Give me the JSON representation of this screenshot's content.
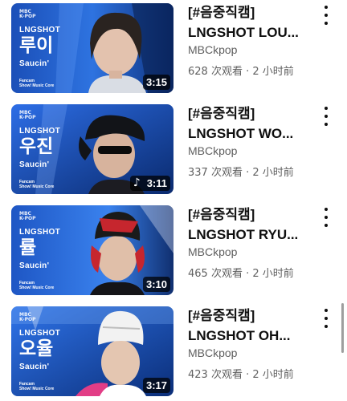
{
  "videos": [
    {
      "thumb_logo": "MBC\nK-POP",
      "thumb_artist": "LNGSHOT",
      "thumb_member": "루이",
      "thumb_song": "Saucin'",
      "thumb_caption": "Fancam\nShow! Music Core",
      "duration": "3:15",
      "title_line1": "[#음중직캠]",
      "title_line2": "LNGSHOT LOU...",
      "channel": "MBCkpop",
      "meta": "628 次观看 · 2 小时前"
    },
    {
      "thumb_logo": "MBC\nK-POP",
      "thumb_artist": "LNGSHOT",
      "thumb_member": "우진",
      "thumb_song": "Saucin'",
      "thumb_caption": "Fancam\nShow! Music Core",
      "duration": "3:11",
      "music_icon": "♪",
      "title_line1": "[#음중직캠]",
      "title_line2": "LNGSHOT WO...",
      "channel": "MBCkpop",
      "meta": "337 次观看 · 2 小时前"
    },
    {
      "thumb_logo": "MBC\nK-POP",
      "thumb_artist": "LNGSHOT",
      "thumb_member": "률",
      "thumb_song": "Saucin'",
      "thumb_caption": "Fancam\nShow! Music Core",
      "duration": "3:10",
      "title_line1": "[#음중직캠]",
      "title_line2": "LNGSHOT RYU...",
      "channel": "MBCkpop",
      "meta": "465 次观看 · 2 小时前"
    },
    {
      "thumb_logo": "MBC\nK-POP",
      "thumb_artist": "LNGSHOT",
      "thumb_member": "오율",
      "thumb_song": "Saucin'",
      "thumb_caption": "Fancam\nShow! Music Core",
      "duration": "3:17",
      "title_line1": "[#음중직캠]",
      "title_line2": "LNGSHOT OH...",
      "channel": "MBCkpop",
      "meta": "423 次观看 · 2 小时前"
    }
  ],
  "colors": {
    "title": "#0f0f0f",
    "secondary": "#606060",
    "thumb_blue": "#1f5fd0"
  },
  "icons": {
    "more": "more-vert-icon",
    "music": "music-note-icon"
  }
}
